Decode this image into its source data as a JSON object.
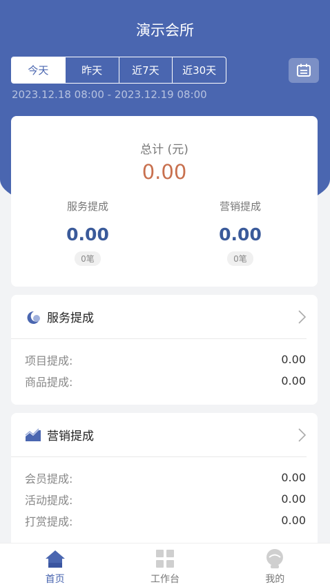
{
  "header": {
    "title": "演示会所"
  },
  "tabs": [
    {
      "label": "今天"
    },
    {
      "label": "昨天"
    },
    {
      "label": "近7天"
    },
    {
      "label": "近30天"
    }
  ],
  "date_range": "2023.12.18 08:00 - 2023.12.19 08:00",
  "summary": {
    "total_label": "总计 (元)",
    "total_value": "0.00",
    "service": {
      "label": "服务提成",
      "value": "0.00",
      "count": "0笔"
    },
    "marketing": {
      "label": "营销提成",
      "value": "0.00",
      "count": "0笔"
    }
  },
  "service_section": {
    "title": "服务提成",
    "rows": [
      {
        "label": "项目提成:",
        "value": "0.00"
      },
      {
        "label": "商品提成:",
        "value": "0.00"
      }
    ]
  },
  "marketing_section": {
    "title": "营销提成",
    "rows": [
      {
        "label": "会员提成:",
        "value": "0.00"
      },
      {
        "label": "活动提成:",
        "value": "0.00"
      },
      {
        "label": "打赏提成:",
        "value": "0.00"
      }
    ]
  },
  "nav": [
    {
      "label": "首页",
      "icon": "home-icon",
      "active": true
    },
    {
      "label": "工作台",
      "icon": "grid-icon",
      "active": false
    },
    {
      "label": "我的",
      "icon": "user-icon",
      "active": false
    }
  ],
  "colors": {
    "primary": "#4a66b0",
    "total": "#c8704e",
    "value": "#3a5a9a"
  }
}
